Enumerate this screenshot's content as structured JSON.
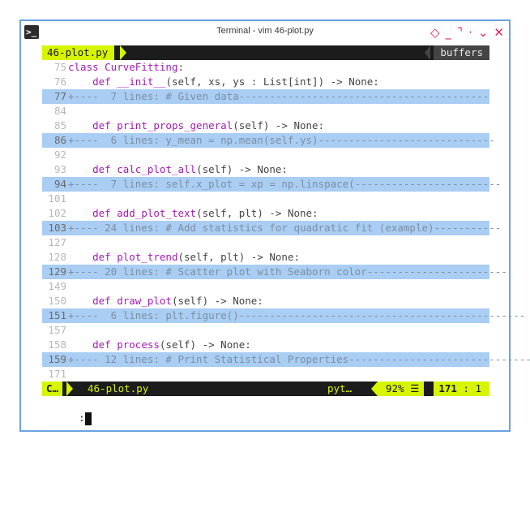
{
  "window": {
    "title": "Terminal - vim 46-plot.py",
    "icon": "terminal-icon",
    "controls": [
      {
        "name": "shade-button",
        "glyph": "◇"
      },
      {
        "name": "minimize-button",
        "glyph": "_"
      },
      {
        "name": "maximize-button",
        "glyph": "⌝"
      },
      {
        "name": "stick-button",
        "glyph": "·"
      },
      {
        "name": "menu-button",
        "glyph": "⌄"
      },
      {
        "name": "close-button",
        "glyph": "✕"
      }
    ]
  },
  "tabline": {
    "active_tab": "46-plot.py",
    "buffers_label": "buffers"
  },
  "lines": [
    {
      "num": "75",
      "fold": false,
      "kw": "class ",
      "name": "CurveFitting",
      "rest": ":"
    },
    {
      "num": "76",
      "fold": false,
      "indent": "    ",
      "kw": "def ",
      "name": "__init__",
      "rest": "(self, xs, ys : List[int]) -> None:"
    },
    {
      "num": "77",
      "fold": true,
      "text": "+----  7 lines: # Given data-----------------------------------------"
    },
    {
      "num": "84",
      "fold": false,
      "text": ""
    },
    {
      "num": "85",
      "fold": false,
      "indent": "    ",
      "kw": "def ",
      "name": "print_props_general",
      "rest": "(self) -> None:"
    },
    {
      "num": "86",
      "fold": true,
      "text": "+----  6 lines: y_mean = np.mean(self.ys)-----------------------------"
    },
    {
      "num": "92",
      "fold": false,
      "text": ""
    },
    {
      "num": "93",
      "fold": false,
      "indent": "    ",
      "kw": "def ",
      "name": "calc_plot_all",
      "rest": "(self) -> None:"
    },
    {
      "num": "94",
      "fold": true,
      "text": "+----  7 lines: self.x_plot = xp = np.linspace(------------------------"
    },
    {
      "num": "101",
      "fold": false,
      "text": ""
    },
    {
      "num": "102",
      "fold": false,
      "indent": "    ",
      "kw": "def ",
      "name": "add_plot_text",
      "rest": "(self, plt) -> None:"
    },
    {
      "num": "103",
      "fold": true,
      "text": "+---- 24 lines: # Add statistics for quadratic fit (example)-----------"
    },
    {
      "num": "127",
      "fold": false,
      "text": ""
    },
    {
      "num": "128",
      "fold": false,
      "indent": "    ",
      "kw": "def ",
      "name": "plot_trend",
      "rest": "(self, plt) -> None:"
    },
    {
      "num": "129",
      "fold": true,
      "text": "+---- 20 lines: # Scatter plot with Seaborn color-----------------------"
    },
    {
      "num": "149",
      "fold": false,
      "text": ""
    },
    {
      "num": "150",
      "fold": false,
      "indent": "    ",
      "kw": "def ",
      "name": "draw_plot",
      "rest": "(self) -> None:"
    },
    {
      "num": "151",
      "fold": true,
      "text": "+----  6 lines: plt.figure()-----------------------------------------------"
    },
    {
      "num": "157",
      "fold": false,
      "text": ""
    },
    {
      "num": "158",
      "fold": false,
      "indent": "    ",
      "kw": "def ",
      "name": "process",
      "rest": "(self) -> None:"
    },
    {
      "num": "159",
      "fold": true,
      "text": "+---- 12 lines: # Print Statistical Properties------------------------------"
    },
    {
      "num": "171",
      "fold": false,
      "text": ""
    }
  ],
  "statusline": {
    "mode": "C…",
    "filename": "46-plot.py",
    "filetype": "pyt…",
    "percent": "92%",
    "percent_icon": "☰",
    "line": "171",
    "col": ": 1"
  },
  "cmdline": {
    "text": ":"
  },
  "colors": {
    "accent": "#d7f500",
    "fold_bg": "#a9cdf3",
    "keyword": "#a51bb5",
    "window_border": "#6aa3e0",
    "controls": "#e0245e"
  }
}
